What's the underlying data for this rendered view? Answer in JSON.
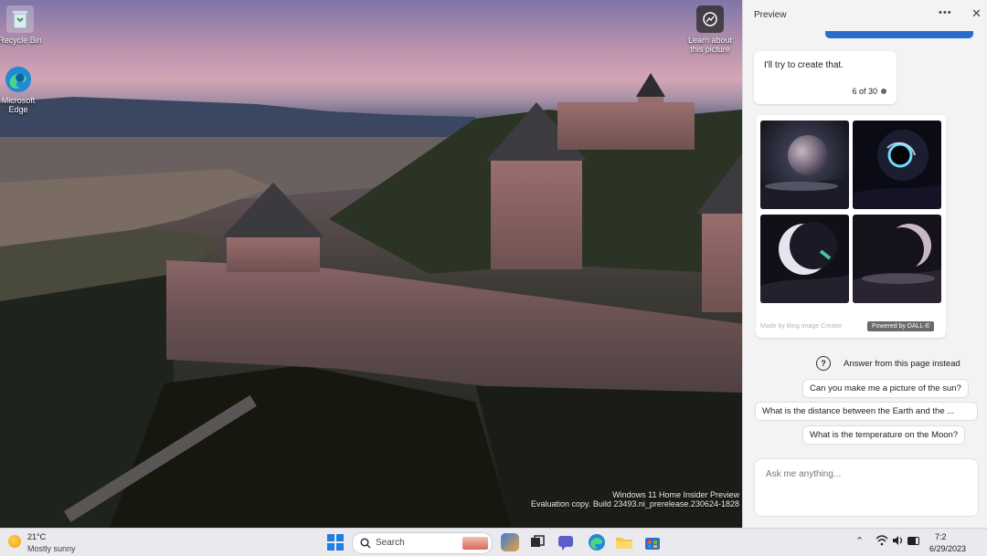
{
  "desktop": {
    "icons": [
      {
        "label": "Recycle Bin"
      },
      {
        "label": "Microsoft Edge"
      }
    ],
    "learn_about": {
      "label_line1": "Learn about",
      "label_line2": "this picture"
    },
    "watermark": {
      "line1": "Windows 11 Home Insider Preview",
      "line2": "Evaluation copy. Build 23493.ni_prerelease.230624-1828"
    }
  },
  "panel": {
    "title": "Preview",
    "more_icon": "more-dots-icon",
    "close_icon": "close-icon",
    "bot_message": "I'll try to create that.",
    "turn_count": "6 of 30",
    "image_credit": "Made by Bing Image Creator",
    "powered_by": "Powered by DALL-E",
    "answer_from_page": "Answer from this page instead",
    "suggestions": [
      "Can you make me a picture of the sun?",
      "What is the distance between the Earth and the ...",
      "What is the temperature on the Moon?"
    ],
    "ask_placeholder": "Ask me anything..."
  },
  "taskbar": {
    "weather_temp": "21°C",
    "weather_desc": "Mostly sunny",
    "search_label": "Search",
    "time": "7:2",
    "date": "6/29/2023"
  },
  "colors": {
    "accent": "#2a6ccc",
    "panel_bg": "#f3f3f3",
    "taskbar_bg": "#e9e9ee"
  }
}
